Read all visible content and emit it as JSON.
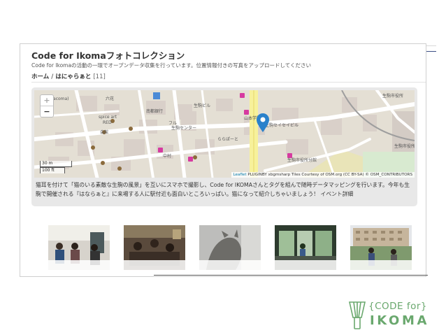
{
  "page": {
    "title": "Code for Ikomaフォトコレクション",
    "subtitle": "Code for Ikomaの活動の一環でオープンデータ収集を行っています。位置情報付きの写真をアップロードしてください"
  },
  "breadcrumb": {
    "home": "ホーム",
    "separator": "/",
    "current": "はにゃらぁと",
    "count": "[11]"
  },
  "map": {
    "zoom_in": "+",
    "zoom_out": "−",
    "scale_m": "30 m",
    "scale_ft": "100 ft",
    "attribution_leaflet": "Leaflet",
    "attribution_rest": " PLUGINBY xbgmsharp Tiles Courtesy of OSM.org (CC BY-SA) © OSM_CONTRIBUTORS",
    "labels": {
      "topleft": "(Tacoma)",
      "rokuhana": "六花",
      "spice": "spice art",
      "red": "RED",
      "minami": "南都銀行",
      "kaikan": "会館",
      "furu": "フル",
      "center": "生駒センター",
      "ikomaekimae": "生駒駅前",
      "building": "生駒ビル",
      "yamamoto": "山本学院",
      "seisei": "生駒セイセイビル",
      "rarapoto": "ららぽーと",
      "nakamura": "中村",
      "ikoma_shiyakusho_top": "生駒市役所",
      "ikomashi": "生駒市役所",
      "yobi": "生駒税務署",
      "bunkan": "生駒市役所分館",
      "keisatsu": "生駒市警察"
    },
    "colors": {
      "main_road": "#f7f19b",
      "marker": "#2a81cb",
      "poi": "#d63aa0"
    }
  },
  "description": {
    "text": "猫耳を付けて「猫のいる素敵な生駒の風景」を互いにスマホで撮影し、Code for IKOMAさんとタグを組んで随時データマッピングを行います。今年も生駒で開催される『はならぁと』に来場する人に駅付近も面白いところいっぱい。猫になって紹介しちゃいましょう！ イベント詳細"
  },
  "logo": {
    "line1": "{CODE for}",
    "line2": "IKOMA",
    "color": "#6aa86e"
  }
}
